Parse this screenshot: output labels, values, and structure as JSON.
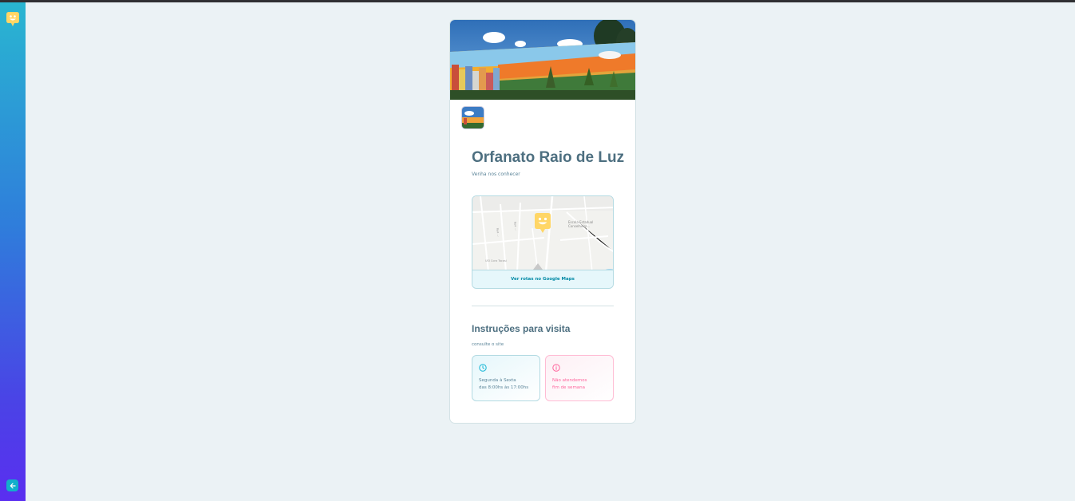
{
  "sidebar": {
    "logo_icon": "happy-pin-logo-icon",
    "back_icon": "arrow-left-icon"
  },
  "orphanage": {
    "name": "Orfanato Raio de Luz",
    "about": "Venha nos conhecer"
  },
  "map": {
    "link_label": "Ver rotas no Google Maps",
    "labels": [
      "Escola Estadual",
      "Conselheiro...",
      "Rua ...",
      "Rua ...",
      "USI Cora Tacasi"
    ]
  },
  "instructions": {
    "title": "Instruções para visita",
    "text": "consulte o site",
    "opening_hours": {
      "line1": "Segunda à Sexta",
      "line2": "das 8:00hs às 17:00hs",
      "icon": "clock-icon"
    },
    "weekends": {
      "line1": "Não atendemos",
      "line2": "fim de semana",
      "icon": "info-icon"
    }
  },
  "colors": {
    "background": "#ebf2f5",
    "sidebar_top": "#29b6d1",
    "sidebar_bottom": "#5a2ef0",
    "title": "#4d6f80",
    "accent_blue": "#0089a5",
    "accent_pink": "#ff669d",
    "marker_yellow": "#ffd666"
  }
}
